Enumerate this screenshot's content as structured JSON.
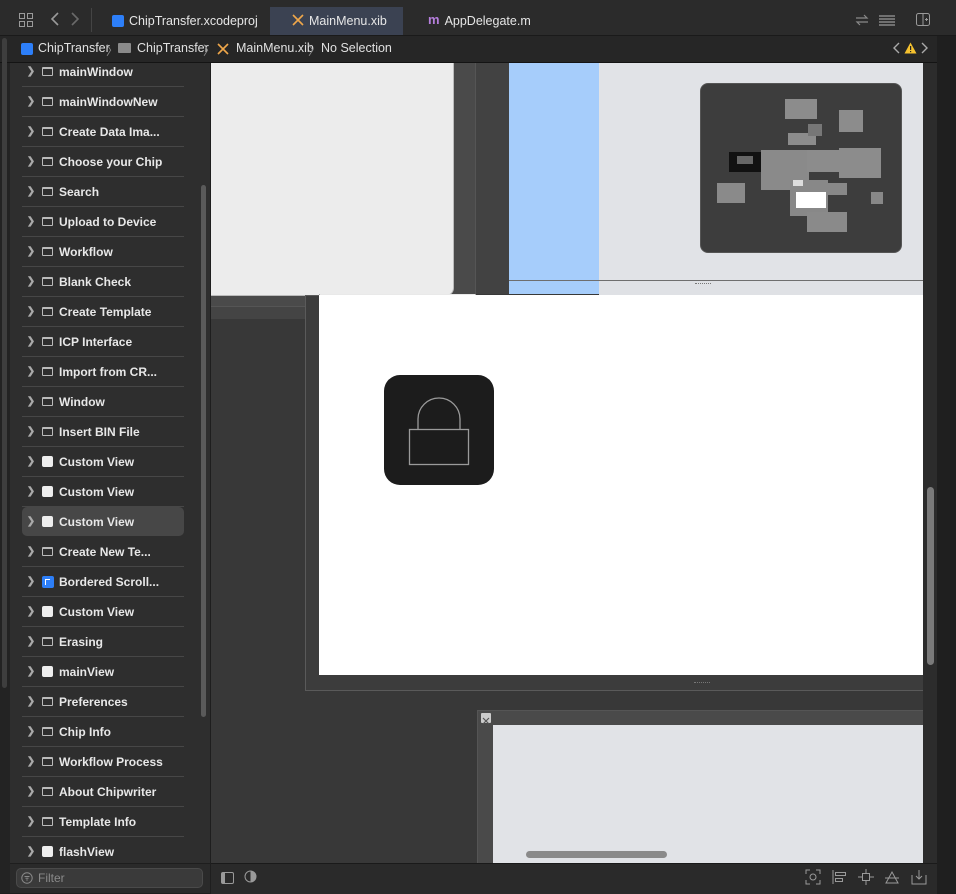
{
  "tabs": [
    {
      "label": "ChipTransfer.xcodeproj",
      "icon": "xcodeproj-icon"
    },
    {
      "label": "MainMenu.xib",
      "icon": "xib-icon",
      "active": true
    },
    {
      "label": "AppDelegate.m",
      "icon": "objc-file-icon"
    }
  ],
  "path": {
    "project": "ChipTransfer",
    "folder": "ChipTransfer",
    "file": "MainMenu.xib",
    "selection": "No Selection"
  },
  "outline": [
    {
      "label": "mainWindow",
      "icon": "window-icon"
    },
    {
      "label": "mainWindowNew",
      "icon": "window-icon"
    },
    {
      "label": "Create Data Ima...",
      "icon": "window-icon"
    },
    {
      "label": "Choose your Chip",
      "icon": "window-icon"
    },
    {
      "label": "Search",
      "icon": "window-icon"
    },
    {
      "label": "Upload to Device",
      "icon": "window-icon"
    },
    {
      "label": "Workflow",
      "icon": "window-icon"
    },
    {
      "label": "Blank Check",
      "icon": "window-icon"
    },
    {
      "label": "Create Template",
      "icon": "window-icon"
    },
    {
      "label": "ICP Interface",
      "icon": "window-icon"
    },
    {
      "label": "Import from CR...",
      "icon": "window-icon"
    },
    {
      "label": "Window",
      "icon": "window-icon"
    },
    {
      "label": "Insert BIN File",
      "icon": "window-icon"
    },
    {
      "label": "Custom View",
      "icon": "view-icon"
    },
    {
      "label": "Custom View",
      "icon": "view-icon"
    },
    {
      "label": "Custom View",
      "icon": "view-icon",
      "selected": true
    },
    {
      "label": "Create New Te...",
      "icon": "window-icon"
    },
    {
      "label": "Bordered Scroll...",
      "icon": "scroll-view-icon"
    },
    {
      "label": "Custom View",
      "icon": "view-icon"
    },
    {
      "label": "Erasing",
      "icon": "window-icon"
    },
    {
      "label": "mainView",
      "icon": "view-icon"
    },
    {
      "label": "Preferences",
      "icon": "window-icon"
    },
    {
      "label": "Chip Info",
      "icon": "window-icon"
    },
    {
      "label": "Workflow Process",
      "icon": "window-icon"
    },
    {
      "label": "About Chipwriter",
      "icon": "window-icon"
    },
    {
      "label": "Template Info",
      "icon": "window-icon"
    },
    {
      "label": "flashView",
      "icon": "view-icon"
    }
  ],
  "filter": {
    "placeholder": "Filter"
  },
  "colors": {
    "accent": "#2d7ff9",
    "selection_row": "#474747",
    "canvas": "#383838",
    "blue_view": "#a6cdfb"
  }
}
